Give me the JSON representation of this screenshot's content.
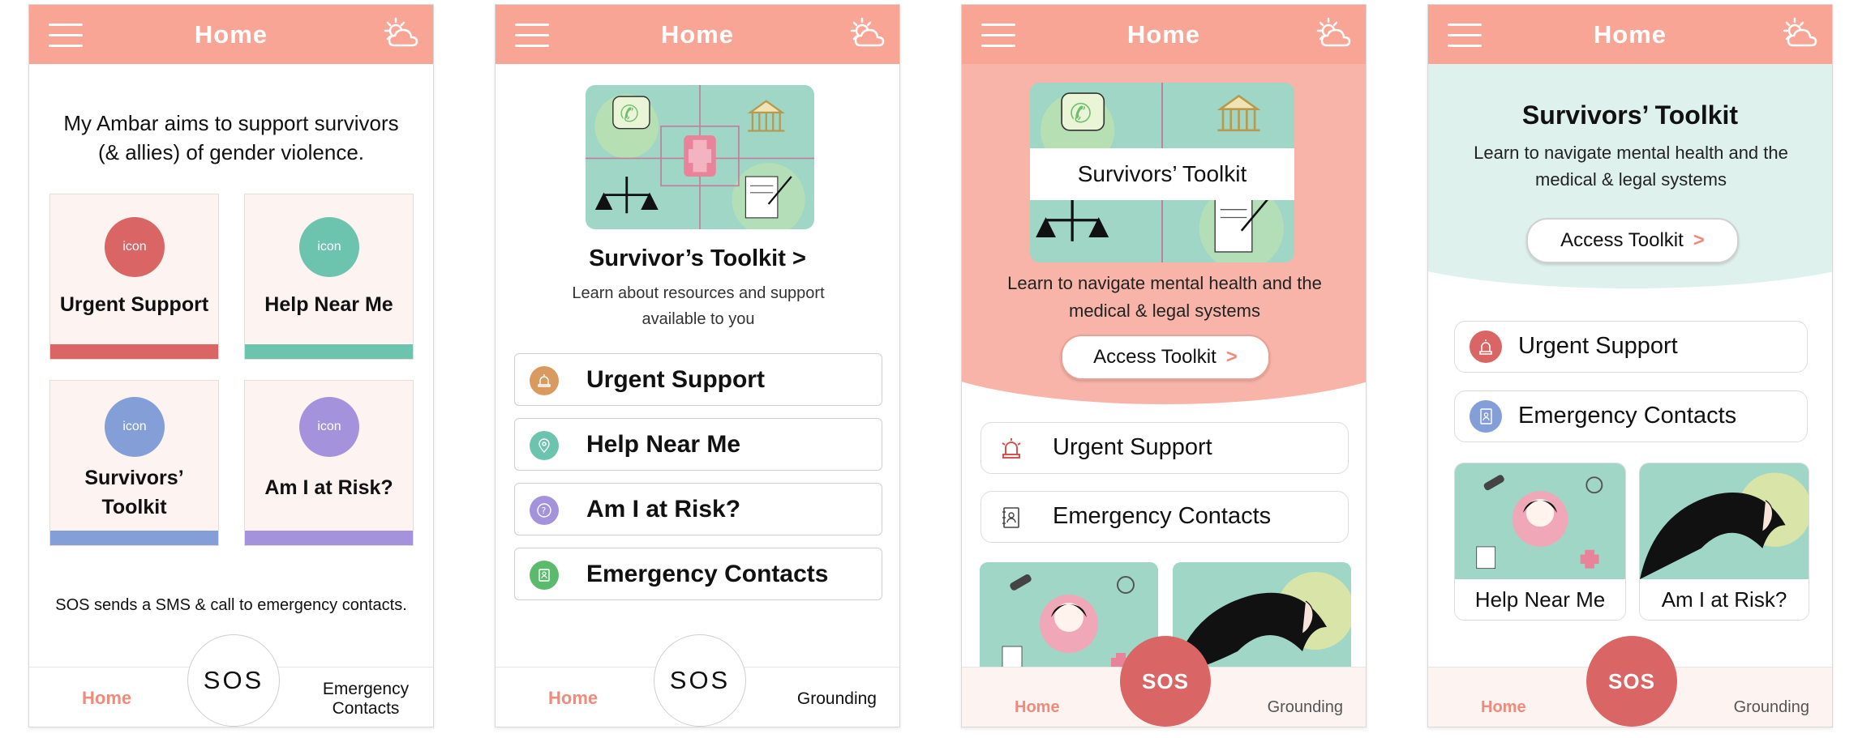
{
  "screens": [
    {
      "header": {
        "title": "Home"
      },
      "intro": "My Ambar aims to support survivors (& allies) of gender violence.",
      "tiles": [
        {
          "icon": "icon",
          "label": "Urgent Support",
          "color": "#d96564"
        },
        {
          "icon": "icon",
          "label": "Help Near Me",
          "color": "#6cc3ae"
        },
        {
          "icon": "icon",
          "label": "Survivors’ Toolkit",
          "color": "#849fd8"
        },
        {
          "icon": "icon",
          "label": "Am I at Risk?",
          "color": "#a492dc"
        }
      ],
      "sos_note": "SOS sends a SMS & call to emergency contacts.",
      "nav": {
        "home": "Home",
        "sos": "SOS",
        "right": "Emergency Contacts"
      }
    },
    {
      "header": {
        "title": "Home"
      },
      "toolkit": {
        "title": "Survivor’s Toolkit  >",
        "subtitle": "Learn about resources and support available to you"
      },
      "list": [
        {
          "label": "Urgent Support",
          "color": "#d99a5f"
        },
        {
          "label": "Help Near Me",
          "color": "#6cc3ae"
        },
        {
          "label": "Am I at Risk?",
          "color": "#a492dc"
        },
        {
          "label": "Emergency Contacts",
          "color": "#5cba6d"
        }
      ],
      "nav": {
        "home": "Home",
        "sos": "SOS",
        "right": "Grounding"
      }
    },
    {
      "header": {
        "title": "Home"
      },
      "toolkit": {
        "title": "Survivors’ Toolkit",
        "subtitle": "Learn to navigate mental health and the medical & legal systems",
        "button": "Access Toolkit"
      },
      "list": [
        {
          "label": "Urgent Support"
        },
        {
          "label": "Emergency Contacts"
        }
      ],
      "nav": {
        "home": "Home",
        "sos": "SOS",
        "right": "Grounding"
      }
    },
    {
      "header": {
        "title": "Home"
      },
      "toolkit": {
        "title": "Survivors’ Toolkit",
        "subtitle": "Learn to navigate mental health and the medical & legal systems",
        "button": "Access Toolkit"
      },
      "list": [
        {
          "label": "Urgent Support"
        },
        {
          "label": "Emergency Contacts"
        }
      ],
      "cards": [
        {
          "label": "Help Near Me"
        },
        {
          "label": "Am I at Risk?"
        }
      ],
      "nav": {
        "home": "Home",
        "sos": "SOS",
        "right": "Grounding"
      }
    }
  ],
  "colors": {
    "header": "#f8a595",
    "accent": "#f08a7a",
    "sos_red": "#d96564",
    "pink_band": "#f8b4a8",
    "mint_band": "#dff1ec"
  }
}
